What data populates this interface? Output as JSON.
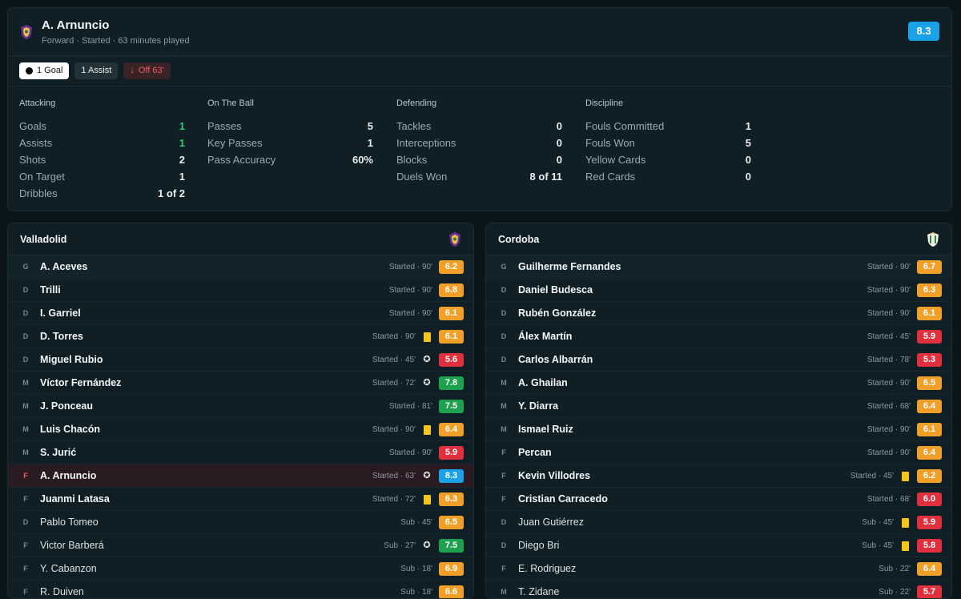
{
  "player": {
    "name": "A. Arnuncio",
    "meta": "Forward · Started · 63 minutes played",
    "rating": "8.3",
    "badges": {
      "goal": "1 Goal",
      "assist": "1 Assist",
      "off": "Off 63'"
    }
  },
  "stats": [
    {
      "title": "Attacking",
      "rows": [
        {
          "label": "Goals",
          "value": "1",
          "highlight": true
        },
        {
          "label": "Assists",
          "value": "1",
          "highlight": true
        },
        {
          "label": "Shots",
          "value": "2"
        },
        {
          "label": "On Target",
          "value": "1"
        },
        {
          "label": "Dribbles",
          "value": "1 of 2"
        }
      ]
    },
    {
      "title": "On The Ball",
      "rows": [
        {
          "label": "Passes",
          "value": "5"
        },
        {
          "label": "Key Passes",
          "value": "1"
        },
        {
          "label": "Pass Accuracy",
          "value": "60%"
        }
      ]
    },
    {
      "title": "Defending",
      "rows": [
        {
          "label": "Tackles",
          "value": "0"
        },
        {
          "label": "Interceptions",
          "value": "0"
        },
        {
          "label": "Blocks",
          "value": "0"
        },
        {
          "label": "Duels Won",
          "value": "8 of 11"
        }
      ]
    },
    {
      "title": "Discipline",
      "rows": [
        {
          "label": "Fouls Committed",
          "value": "1"
        },
        {
          "label": "Fouls Won",
          "value": "5"
        },
        {
          "label": "Yellow Cards",
          "value": "0"
        },
        {
          "label": "Red Cards",
          "value": "0"
        }
      ]
    }
  ],
  "home": {
    "name": "Valladolid",
    "players": [
      {
        "pos": "G",
        "name": "A. Aceves",
        "meta": "Started · 90'",
        "rating": "6.2",
        "color": "orange",
        "starter": true
      },
      {
        "pos": "D",
        "name": "Trilli",
        "meta": "Started · 90'",
        "rating": "6.8",
        "color": "orange",
        "starter": true
      },
      {
        "pos": "D",
        "name": "I. Garriel",
        "meta": "Started · 90'",
        "rating": "6.1",
        "color": "orange",
        "starter": true
      },
      {
        "pos": "D",
        "name": "D. Torres",
        "meta": "Started · 90'",
        "rating": "6.1",
        "color": "orange",
        "event": "yellow-card",
        "starter": true
      },
      {
        "pos": "D",
        "name": "Miguel Rubio",
        "meta": "Started · 45'",
        "rating": "5.6",
        "color": "red",
        "event": "ball",
        "starter": true
      },
      {
        "pos": "M",
        "name": "Víctor Fernández",
        "meta": "Started · 72'",
        "rating": "7.8",
        "color": "green",
        "event": "ball",
        "starter": true
      },
      {
        "pos": "M",
        "name": "J. Ponceau",
        "meta": "Started · 81'",
        "rating": "7.5",
        "color": "green",
        "starter": true
      },
      {
        "pos": "M",
        "name": "Luis Chacón",
        "meta": "Started · 90'",
        "rating": "6.4",
        "color": "orange",
        "event": "yellow-card",
        "starter": true
      },
      {
        "pos": "M",
        "name": "S. Jurić",
        "meta": "Started · 90'",
        "rating": "5.9",
        "color": "red",
        "starter": true
      },
      {
        "pos": "F",
        "name": "A. Arnuncio",
        "meta": "Started · 63'",
        "rating": "8.3",
        "color": "blue",
        "event": "ball",
        "starter": true,
        "highlight": true
      },
      {
        "pos": "F",
        "name": "Juanmi Latasa",
        "meta": "Started · 72'",
        "rating": "6.3",
        "color": "orange",
        "event": "yellow-card",
        "starter": true
      },
      {
        "pos": "D",
        "name": "Pablo Tomeo",
        "meta": "Sub · 45'",
        "rating": "6.5",
        "color": "orange",
        "starter": false
      },
      {
        "pos": "F",
        "name": "Victor Barberá",
        "meta": "Sub · 27'",
        "rating": "7.5",
        "color": "green",
        "event": "ball",
        "starter": false
      },
      {
        "pos": "F",
        "name": "Y. Cabanzon",
        "meta": "Sub · 18'",
        "rating": "6.9",
        "color": "orange",
        "starter": false
      },
      {
        "pos": "F",
        "name": "R. Duiven",
        "meta": "Sub · 18'",
        "rating": "6.6",
        "color": "orange",
        "starter": false
      }
    ]
  },
  "away": {
    "name": "Cordoba",
    "players": [
      {
        "pos": "G",
        "name": "Guilherme Fernandes",
        "meta": "Started · 90'",
        "rating": "6.7",
        "color": "orange",
        "starter": true
      },
      {
        "pos": "D",
        "name": "Daniel Budesca",
        "meta": "Started · 90'",
        "rating": "6.3",
        "color": "orange",
        "starter": true
      },
      {
        "pos": "D",
        "name": "Rubén González",
        "meta": "Started · 90'",
        "rating": "6.1",
        "color": "orange",
        "starter": true
      },
      {
        "pos": "D",
        "name": "Álex Martín",
        "meta": "Started · 45'",
        "rating": "5.9",
        "color": "red",
        "starter": true
      },
      {
        "pos": "D",
        "name": "Carlos Albarrán",
        "meta": "Started · 78'",
        "rating": "5.3",
        "color": "red",
        "starter": true
      },
      {
        "pos": "M",
        "name": "A. Ghailan",
        "meta": "Started · 90'",
        "rating": "6.5",
        "color": "orange",
        "starter": true
      },
      {
        "pos": "M",
        "name": "Y. Diarra",
        "meta": "Started · 68'",
        "rating": "6.4",
        "color": "orange",
        "starter": true
      },
      {
        "pos": "M",
        "name": "Ismael Ruiz",
        "meta": "Started · 90'",
        "rating": "6.1",
        "color": "orange",
        "starter": true
      },
      {
        "pos": "F",
        "name": "Percan",
        "meta": "Started · 90'",
        "rating": "6.4",
        "color": "orange",
        "starter": true
      },
      {
        "pos": "F",
        "name": "Kevin Villodres",
        "meta": "Started · 45'",
        "rating": "6.2",
        "color": "orange",
        "event": "yellow-card",
        "starter": true
      },
      {
        "pos": "F",
        "name": "Cristian Carracedo",
        "meta": "Started · 68'",
        "rating": "6.0",
        "color": "red",
        "starter": true
      },
      {
        "pos": "D",
        "name": "Juan Gutiérrez",
        "meta": "Sub · 45'",
        "rating": "5.9",
        "color": "red",
        "event": "yellow-card",
        "starter": false
      },
      {
        "pos": "D",
        "name": "Diego Bri",
        "meta": "Sub · 45'",
        "rating": "5.8",
        "color": "red",
        "event": "yellow-card",
        "starter": false
      },
      {
        "pos": "F",
        "name": "E. Rodriguez",
        "meta": "Sub · 22'",
        "rating": "6.4",
        "color": "orange",
        "starter": false
      },
      {
        "pos": "M",
        "name": "T. Zidane",
        "meta": "Sub · 22'",
        "rating": "5.7",
        "color": "red",
        "starter": false
      }
    ]
  },
  "colors": {
    "orange": "#f0a028",
    "red": "#e0303d",
    "green": "#1ea14c",
    "blue": "#1aa1e8"
  },
  "icons": {
    "home_crest": "valladolid-crest-icon",
    "away_crest": "cordoba-crest-icon",
    "ball": "football-icon",
    "card": "yellow-card-icon",
    "off": "arrow-down-icon"
  }
}
